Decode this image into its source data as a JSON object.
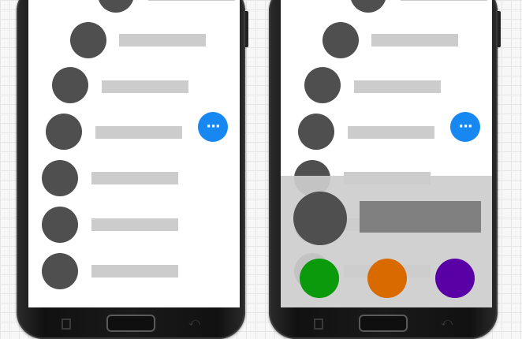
{
  "colors": {
    "avatar": "#4f4f4f",
    "placeholder_bar": "#cccccc",
    "fab": "#1787f2",
    "overlay": "#cdcdcd",
    "overlay_bar": "#808080",
    "action_green": "#0b9a0b",
    "action_orange": "#d86a00",
    "action_purple": "#5800a6"
  },
  "fab": {
    "icon": "more-horizontal-icon",
    "glyph": "···"
  },
  "nav": {
    "recent_icon": "recent-apps-icon",
    "home_icon": "home-button",
    "back_icon": "back-arrow-icon",
    "back_glyph": "⤺"
  },
  "actions": [
    {
      "name": "action-green",
      "color": "#0b9a0b"
    },
    {
      "name": "action-orange",
      "color": "#d86a00"
    },
    {
      "name": "action-purple",
      "color": "#5800a6"
    }
  ]
}
